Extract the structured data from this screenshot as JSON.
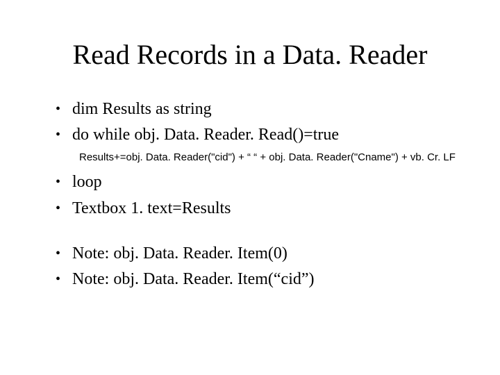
{
  "title": "Read Records in a Data. Reader",
  "bullets": {
    "b1": "dim Results as string",
    "b2": "do while obj. Data. Reader. Read()=true",
    "sub": "Results+=obj. Data. Reader(\"cid\") +  “ “   + obj. Data. Reader(\"Cname\") + vb. Cr. LF",
    "b3": "loop",
    "b4": "Textbox 1. text=Results",
    "b5": "Note: obj. Data. Reader. Item(0)",
    "b6": "Note: obj. Data. Reader. Item(“cid”)"
  }
}
